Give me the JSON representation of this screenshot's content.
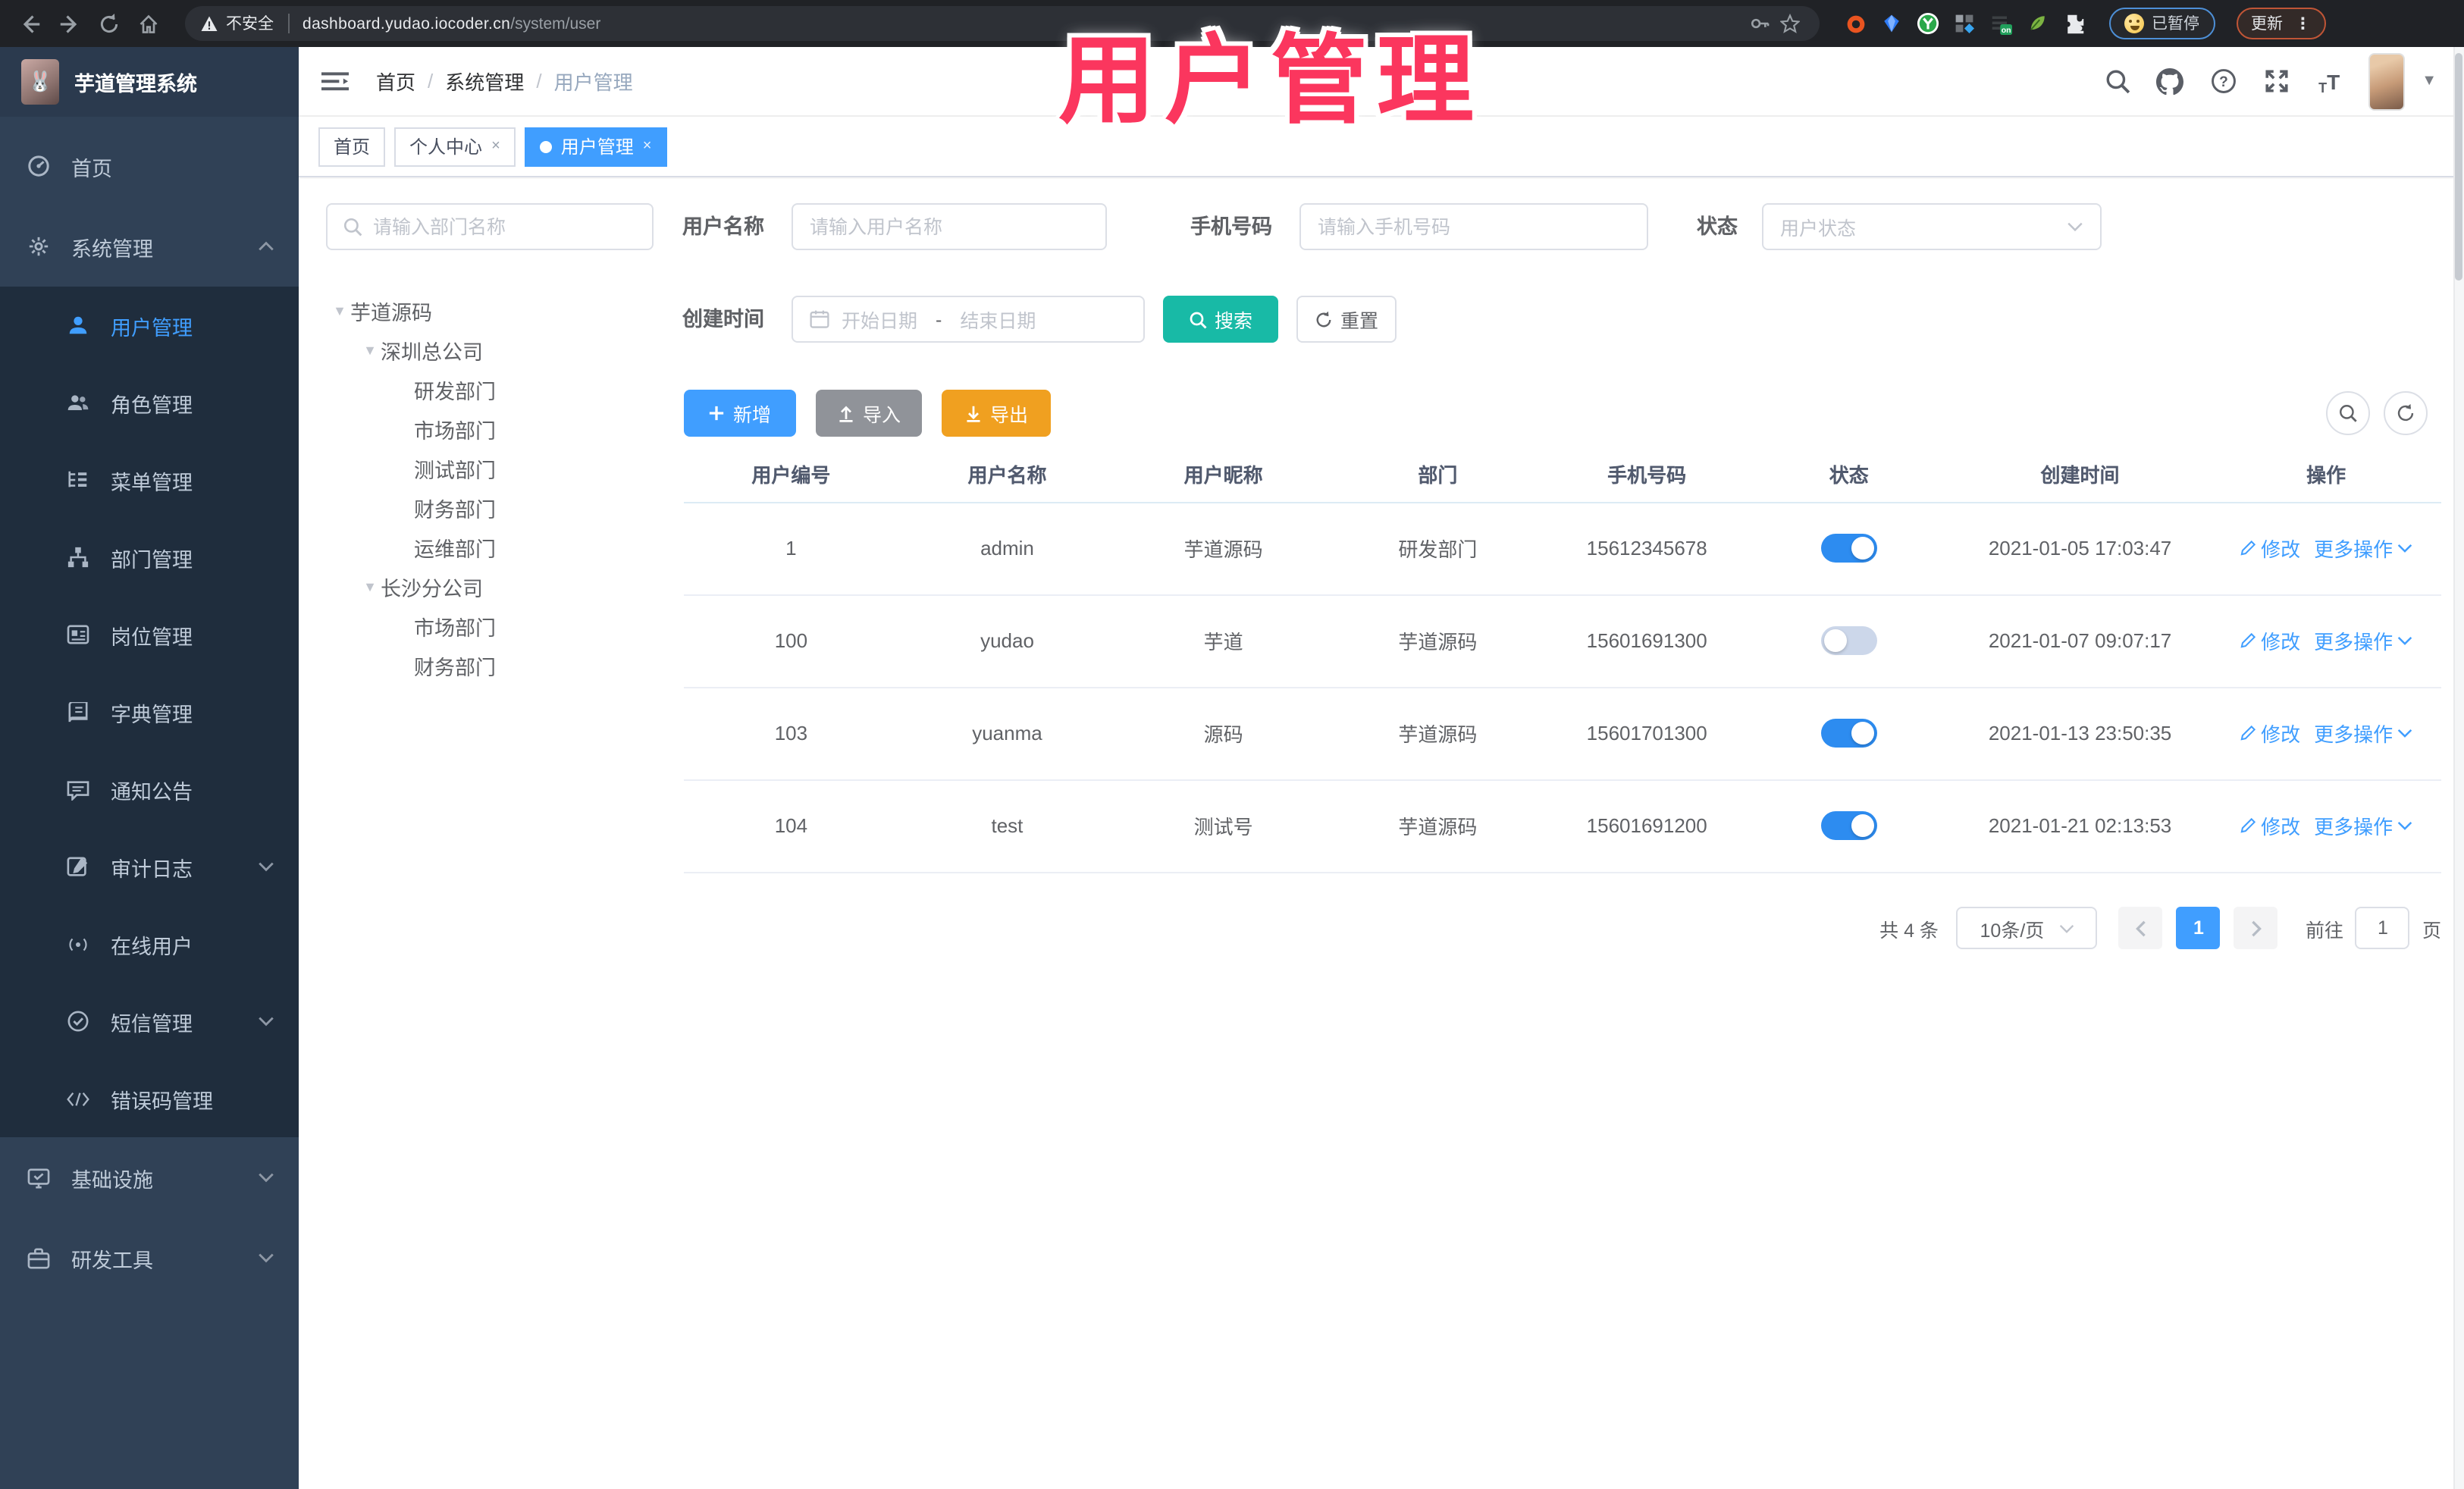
{
  "browser": {
    "security_label": "不安全",
    "url_host": "dashboard.yudao.iocoder.cn",
    "url_path": "/system/user",
    "paused_label": "已暂停",
    "update_label": "更新"
  },
  "overlay": {
    "title": "用户管理",
    "color": "#fb365e"
  },
  "sidebar": {
    "logo_title": "芋道管理系统",
    "items": [
      {
        "label": "首页"
      },
      {
        "label": "系统管理"
      },
      {
        "label": "用户管理"
      },
      {
        "label": "角色管理"
      },
      {
        "label": "菜单管理"
      },
      {
        "label": "部门管理"
      },
      {
        "label": "岗位管理"
      },
      {
        "label": "字典管理"
      },
      {
        "label": "通知公告"
      },
      {
        "label": "审计日志"
      },
      {
        "label": "在线用户"
      },
      {
        "label": "短信管理"
      },
      {
        "label": "错误码管理"
      },
      {
        "label": "基础设施"
      },
      {
        "label": "研发工具"
      }
    ]
  },
  "header": {
    "breadcrumb": [
      "首页",
      "系统管理",
      "用户管理"
    ]
  },
  "tabs": [
    {
      "label": "首页"
    },
    {
      "label": "个人中心",
      "close": "×"
    },
    {
      "label": "用户管理",
      "close": "×"
    }
  ],
  "dept_panel": {
    "search_placeholder": "请输入部门名称",
    "tree": [
      {
        "label": "芋道源码"
      },
      {
        "label": "深圳总公司"
      },
      {
        "label": "研发部门"
      },
      {
        "label": "市场部门"
      },
      {
        "label": "测试部门"
      },
      {
        "label": "财务部门"
      },
      {
        "label": "运维部门"
      },
      {
        "label": "长沙分公司"
      },
      {
        "label": "市场部门"
      },
      {
        "label": "财务部门"
      }
    ]
  },
  "filters": {
    "username_label": "用户名称",
    "username_placeholder": "请输入用户名称",
    "mobile_label": "手机号码",
    "mobile_placeholder": "请输入手机号码",
    "status_label": "状态",
    "status_placeholder": "用户状态",
    "created_label": "创建时间",
    "date_start_placeholder": "开始日期",
    "date_sep": "-",
    "date_end_placeholder": "结束日期",
    "search_label": "搜索",
    "reset_label": "重置"
  },
  "toolbar": {
    "add_label": "新增",
    "import_label": "导入",
    "export_label": "导出"
  },
  "table": {
    "columns": [
      "用户编号",
      "用户名称",
      "用户昵称",
      "部门",
      "手机号码",
      "状态",
      "创建时间",
      "操作"
    ],
    "action_edit": "修改",
    "action_more": "更多操作",
    "rows": [
      {
        "id": "1",
        "name": "admin",
        "nick": "芋道源码",
        "dept": "研发部门",
        "mobile": "15612345678",
        "status": "on",
        "created": "2021-01-05 17:03:47"
      },
      {
        "id": "100",
        "name": "yudao",
        "nick": "芋道",
        "dept": "芋道源码",
        "mobile": "15601691300",
        "status": "off",
        "created": "2021-01-07 09:07:17"
      },
      {
        "id": "103",
        "name": "yuanma",
        "nick": "源码",
        "dept": "芋道源码",
        "mobile": "15601701300",
        "status": "on",
        "created": "2021-01-13 23:50:35"
      },
      {
        "id": "104",
        "name": "test",
        "nick": "测试号",
        "dept": "芋道源码",
        "mobile": "15601691200",
        "status": "on",
        "created": "2021-01-21 02:13:53"
      }
    ]
  },
  "pagination": {
    "total_label": "共 4 条",
    "page_size_label": "10条/页",
    "current_page": "1",
    "goto_label": "前往",
    "goto_value": "1",
    "page_unit": "页"
  },
  "colors": {
    "accent_blue": "#409eff",
    "teal_search": "#18baa6",
    "export_orange": "#f0a020",
    "import_gray": "#909399",
    "sidebar_bg": "#304156",
    "submenu_bg": "#1f2d3d",
    "annotation_pink": "#fb365e"
  }
}
